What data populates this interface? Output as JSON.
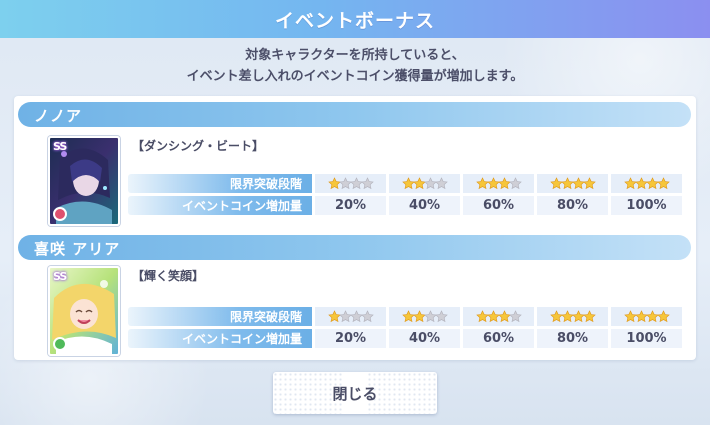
{
  "dialog": {
    "title": "イベントボーナス",
    "description_line1": "対象キャラクターを所持していると、",
    "description_line2": "イベント差し入れのイベントコイン獲得量が増加します。",
    "close_label": "閉じる"
  },
  "table_labels": {
    "limit_break": "限界突破段階",
    "coin_increase": "イベントコイン増加量"
  },
  "characters": [
    {
      "name": "ノノア",
      "card_title": "【ダンシング・ビート】",
      "rarity_badge": "SS",
      "attribute_color": "#e0506f",
      "limit_break_levels": [
        1,
        2,
        3,
        4,
        5
      ],
      "coin_increase": [
        "20%",
        "40%",
        "60%",
        "80%",
        "100%"
      ]
    },
    {
      "name": "喜咲 アリア",
      "card_title": "【輝く笑顔】",
      "rarity_badge": "SS",
      "attribute_color": "#4fba5a",
      "limit_break_levels": [
        1,
        2,
        3,
        4,
        5
      ],
      "coin_increase": [
        "20%",
        "40%",
        "60%",
        "80%",
        "100%"
      ]
    }
  ],
  "colors": {
    "star_filled": "#f6c63a",
    "star_empty": "#cfcfd6"
  }
}
